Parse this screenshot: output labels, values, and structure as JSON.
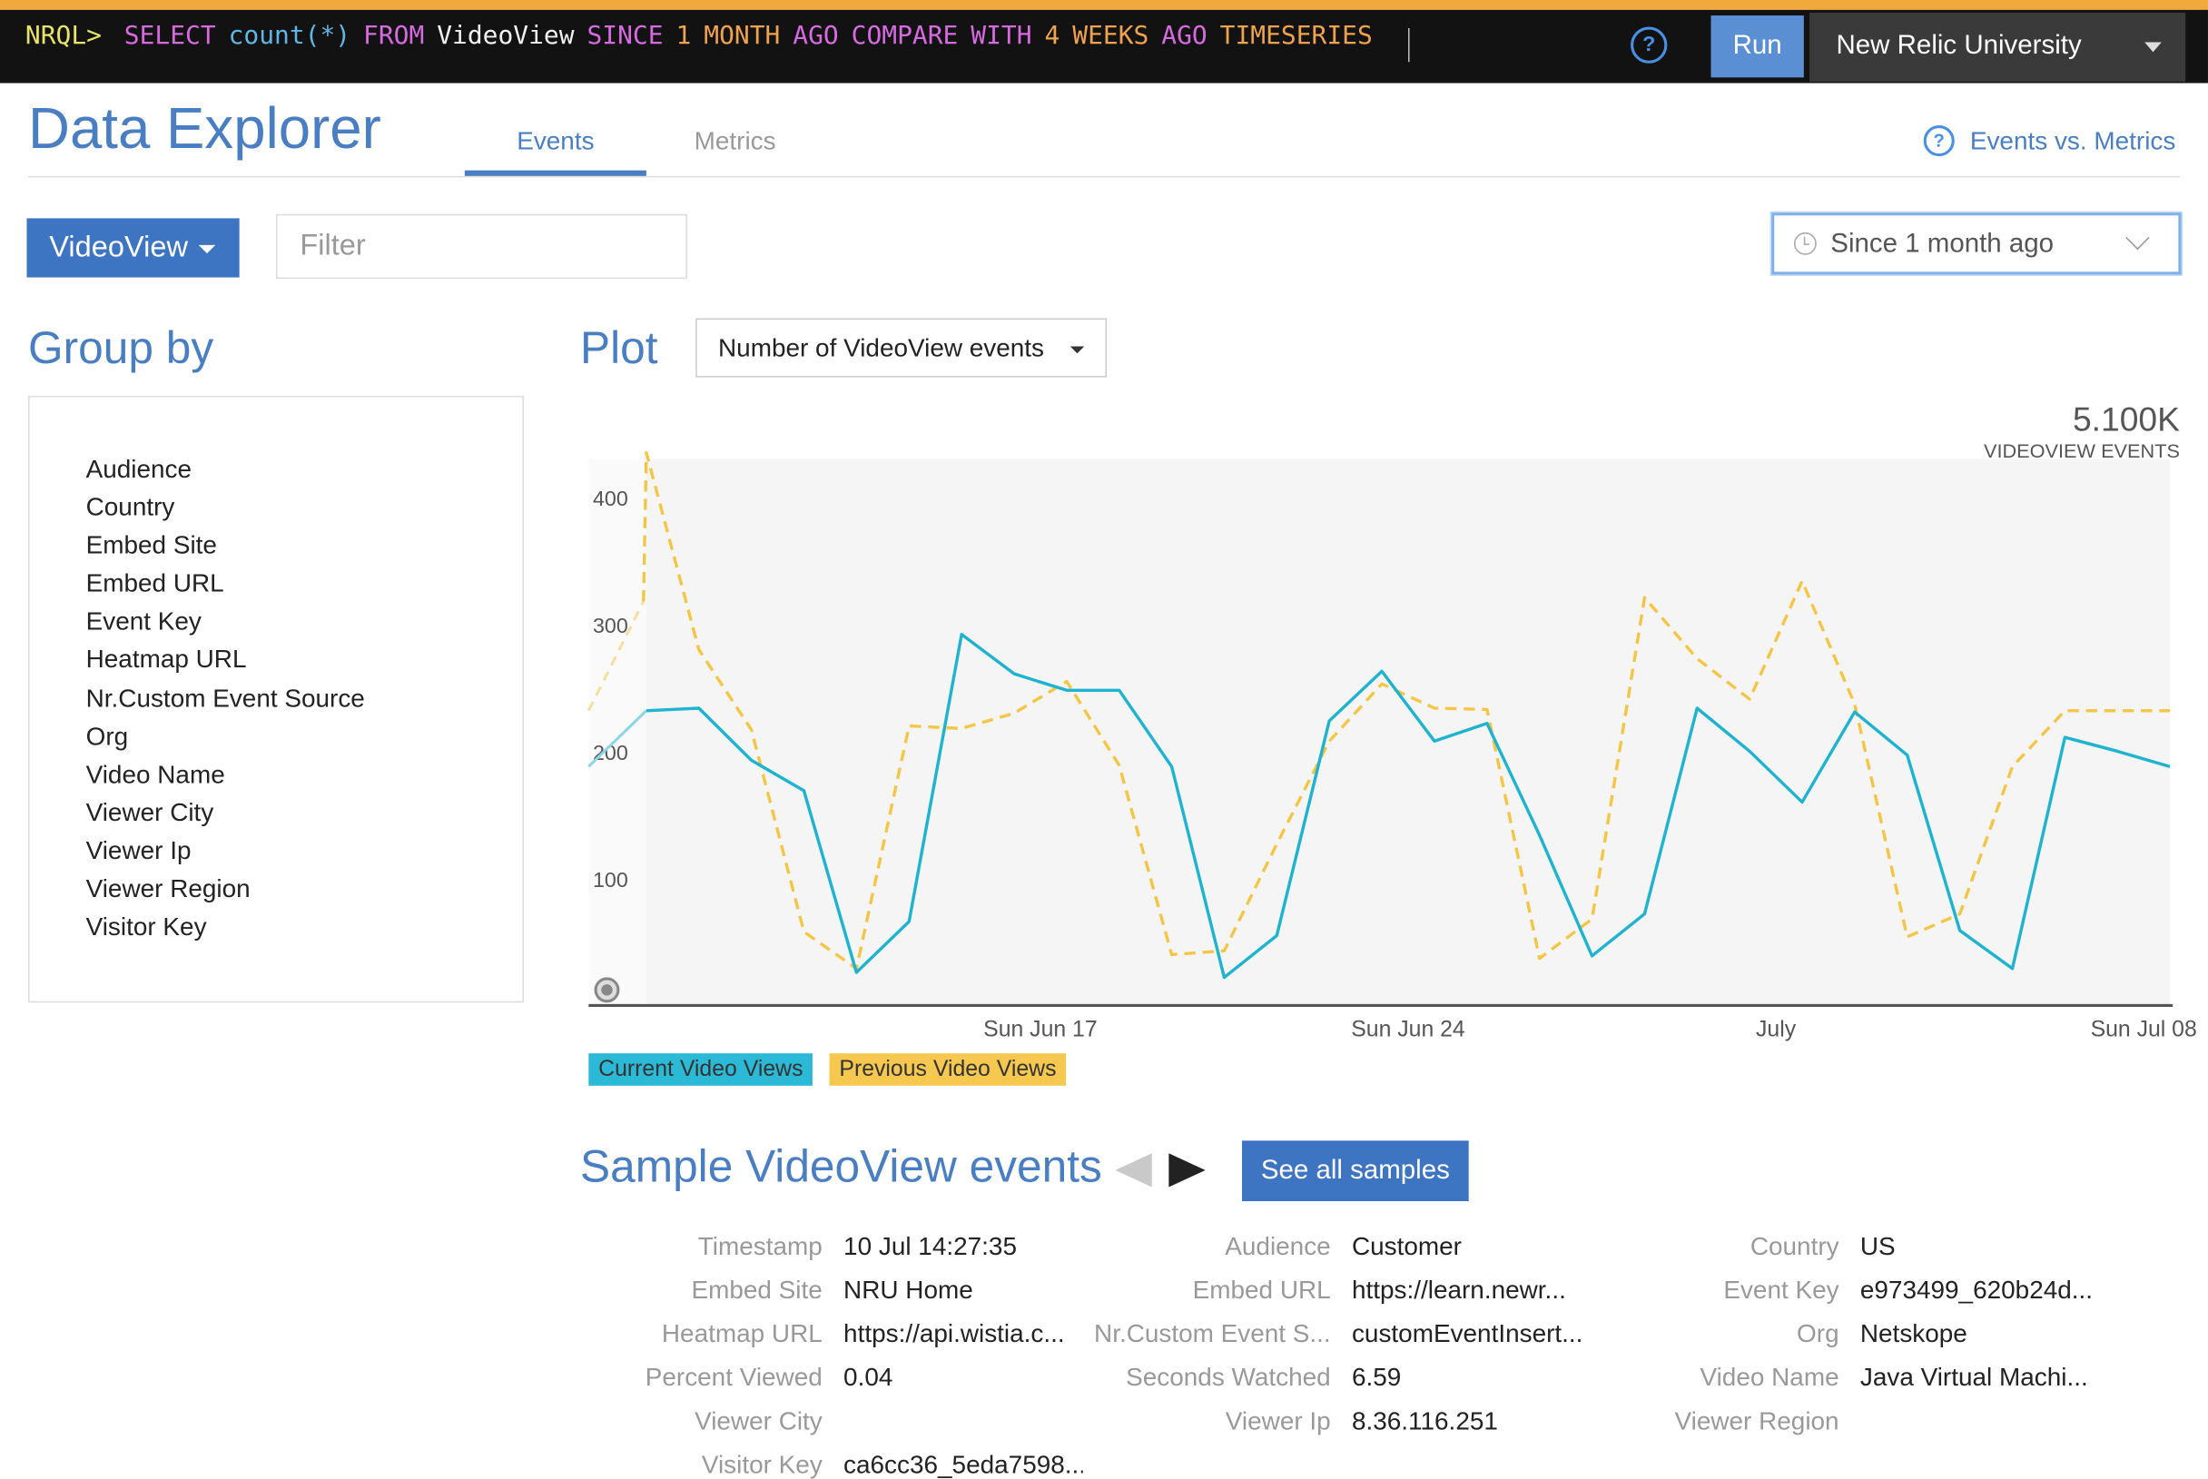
{
  "query_bar": {
    "prompt": "NRQL>",
    "tokens": [
      {
        "text": "SELECT",
        "cls": "k-kw"
      },
      {
        "text": "count(*)",
        "cls": "k-fn"
      },
      {
        "text": "FROM",
        "cls": "k-kw"
      },
      {
        "text": "VideoView",
        "cls": "k-ev"
      },
      {
        "text": "SINCE",
        "cls": "k-kw"
      },
      {
        "text": "1",
        "cls": "k-num"
      },
      {
        "text": "MONTH",
        "cls": "k-unit"
      },
      {
        "text": "AGO",
        "cls": "k-kw"
      },
      {
        "text": "COMPARE",
        "cls": "k-kw"
      },
      {
        "text": "WITH",
        "cls": "k-kw"
      },
      {
        "text": "4",
        "cls": "k-num"
      },
      {
        "text": "WEEKS",
        "cls": "k-unit"
      },
      {
        "text": "AGO",
        "cls": "k-kw"
      },
      {
        "text": "TIMESERIES",
        "cls": "k-time"
      }
    ],
    "help_icon": "question-circle-icon",
    "run_label": "Run",
    "account_name": "New Relic University"
  },
  "header": {
    "title": "Data Explorer",
    "tabs": [
      {
        "label": "Events",
        "active": true
      },
      {
        "label": "Metrics",
        "active": false
      }
    ],
    "help_link": "Events vs. Metrics"
  },
  "controls": {
    "event_type": "VideoView",
    "filter_placeholder": "Filter",
    "time_range": "Since 1 month ago"
  },
  "group_by": {
    "title": "Group by",
    "attributes": [
      "Audience",
      "Country",
      "Embed Site",
      "Embed URL",
      "Event Key",
      "Heatmap URL",
      "Nr.Custom Event Source",
      "Org",
      "Video Name",
      "Viewer City",
      "Viewer Ip",
      "Viewer Region",
      "Visitor Key"
    ]
  },
  "plot": {
    "title": "Plot",
    "metric": "Number of VideoView events",
    "total_value": "5.100K",
    "total_label": "VIDEOVIEW EVENTS"
  },
  "colors": {
    "brand_blue": "#3e75c2",
    "title_blue": "#4a7ec2",
    "current_series": "#1fb3cf",
    "previous_series": "#f4c648",
    "legend_current_bg": "#2bb9d6",
    "legend_previous_bg": "#f6c84f"
  },
  "chart_data": {
    "type": "line",
    "ylim": [
      0,
      430
    ],
    "y_ticks": [
      100,
      200,
      300,
      400
    ],
    "x_ticks": [
      {
        "label": "Sun Jun 17",
        "x": 7.5
      },
      {
        "label": "Sun Jun 24",
        "x": 14.5
      },
      {
        "label": "July",
        "x": 21.5
      },
      {
        "label": "Sun Jul 08",
        "x": 28.5
      }
    ],
    "series": [
      {
        "name": "Current Video Views",
        "style": "solid",
        "x": [
          0,
          1,
          2,
          3,
          4,
          5,
          6,
          7,
          8,
          9,
          10,
          11,
          12,
          13,
          14,
          15,
          16,
          17,
          18,
          19,
          20,
          21,
          22,
          23,
          24,
          25,
          26,
          27,
          28,
          29
        ],
        "values": [
          232,
          234,
          193,
          169,
          26,
          66,
          292,
          261,
          248,
          248,
          188,
          22,
          55,
          224,
          263,
          208,
          222,
          134,
          39,
          72,
          234,
          200,
          160,
          231,
          197,
          59,
          29,
          211,
          200,
          188
        ]
      },
      {
        "name": "Previous Video Views",
        "style": "dashed",
        "x": [
          0,
          1,
          2,
          3,
          4,
          5,
          6,
          7,
          8,
          9,
          10,
          11,
          12,
          13,
          14,
          15,
          16,
          17,
          18,
          19,
          20,
          21,
          22,
          23,
          24,
          25,
          26,
          27,
          28,
          29
        ],
        "values": [
          435,
          280,
          217,
          58,
          29,
          220,
          218,
          230,
          255,
          189,
          40,
          43,
          127,
          208,
          253,
          234,
          233,
          37,
          68,
          321,
          273,
          241,
          334,
          237,
          54,
          72,
          188,
          232,
          232,
          232
        ]
      }
    ]
  },
  "samples": {
    "title": "Sample VideoView events",
    "see_all_label": "See all samples",
    "fields": [
      [
        {
          "label": "Timestamp",
          "value": "10 Jul 14:27:35"
        },
        {
          "label": "Audience",
          "value": "Customer"
        },
        {
          "label": "Country",
          "value": "US"
        }
      ],
      [
        {
          "label": "Embed Site",
          "value": "NRU Home"
        },
        {
          "label": "Embed URL",
          "value": "https://learn.newr..."
        },
        {
          "label": "Event Key",
          "value": "e973499_620b24d..."
        }
      ],
      [
        {
          "label": "Heatmap URL",
          "value": "https://api.wistia.c..."
        },
        {
          "label": "Nr.Custom Event S...",
          "value": "customEventInsert..."
        },
        {
          "label": "Org",
          "value": "Netskope"
        }
      ],
      [
        {
          "label": "Percent Viewed",
          "value": "0.04"
        },
        {
          "label": "Seconds Watched",
          "value": "6.59"
        },
        {
          "label": "Video Name",
          "value": "Java Virtual Machi..."
        }
      ],
      [
        {
          "label": "Viewer City",
          "value": ""
        },
        {
          "label": "Viewer Ip",
          "value": "8.36.116.251"
        },
        {
          "label": "Viewer Region",
          "value": ""
        }
      ],
      [
        {
          "label": "Visitor Key",
          "value": "ca6cc36_5eda7598..."
        }
      ]
    ]
  }
}
